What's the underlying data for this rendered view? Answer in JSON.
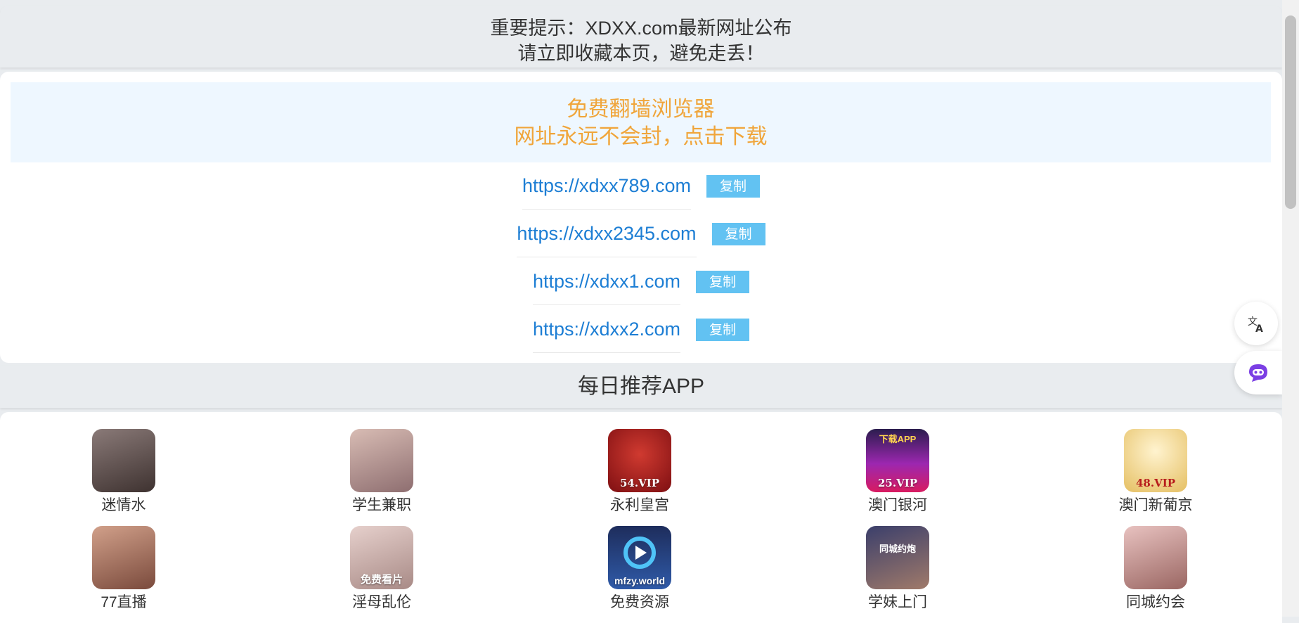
{
  "notice": {
    "line1": "重要提示：XDXX.com最新网址公布",
    "line2": "请立即收藏本页，避免走丢！"
  },
  "promo": {
    "line1": "免费翻墙浏览器",
    "line2": "网址永远不会封，点击下载"
  },
  "links": [
    {
      "url": "https://xdxx789.com",
      "copy_label": "复制"
    },
    {
      "url": "https://xdxx2345.com",
      "copy_label": "复制"
    },
    {
      "url": "https://xdxx1.com",
      "copy_label": "复制"
    },
    {
      "url": "https://xdxx2.com",
      "copy_label": "复制"
    }
  ],
  "section": {
    "title": "每日推荐APP"
  },
  "apps": [
    {
      "name": "迷情水",
      "icon": "photo-icon",
      "color": "#6a5a58"
    },
    {
      "name": "学生兼职",
      "icon": "photo-icon",
      "color": "#b89890"
    },
    {
      "name": "永利皇宫",
      "icon": "casino-logo-icon",
      "color": "#a8191c",
      "badge": "54.VIP"
    },
    {
      "name": "澳门银河",
      "icon": "casino-logo-icon",
      "color": "#7b1fa2",
      "badge": "25.VIP",
      "badge_top": "下载APP"
    },
    {
      "name": "澳门新葡京",
      "icon": "casino-logo-icon",
      "color": "#e9c66a",
      "badge": "48.VIP"
    },
    {
      "name": "77直播",
      "icon": "photo-icon",
      "color": "#b07a66"
    },
    {
      "name": "淫母乱伦",
      "icon": "photo-icon",
      "color": "#c9a9a6",
      "badge": "免费看片"
    },
    {
      "name": "免费资源",
      "icon": "play-logo-icon",
      "color": "#1f3a6e",
      "badge": "mfzy.world"
    },
    {
      "name": "学妹上门",
      "icon": "photo-icon",
      "color": "#7c6a8e",
      "badge_top": "同城约炮"
    },
    {
      "name": "同城约会",
      "icon": "photo-icon",
      "color": "#c28e8e"
    }
  ],
  "floating": {
    "translate_icon": "translate-icon",
    "assistant_icon": "assistant-icon"
  }
}
